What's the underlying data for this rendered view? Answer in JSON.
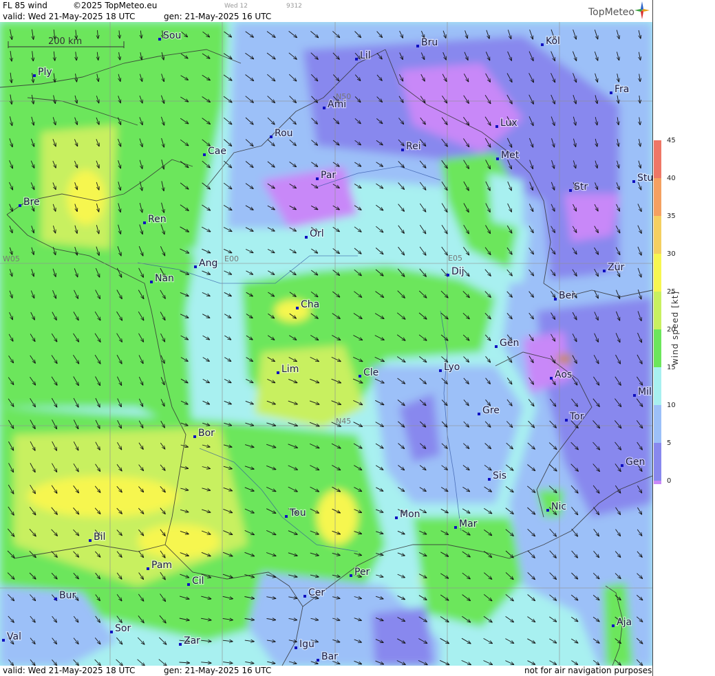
{
  "header": {
    "product": "FL 85 wind",
    "copyright": "©2025 TopMeteo.eu",
    "run_tag": "Wed 12",
    "code": "9312",
    "valid_line": "valid:  Wed  21-May-2025  18 UTC",
    "gen_line": "gen: 21-May-2025 16 UTC"
  },
  "logo": {
    "name": "TopMeteo"
  },
  "footer": {
    "valid_line": "valid:  Wed  21-May-2025  18 UTC",
    "gen_line": "gen: 21-May-2025 16 UTC",
    "disclaimer": "not for air navigation purposes"
  },
  "scale": {
    "label": "200 km"
  },
  "legend": {
    "title": "wind speed [kt]",
    "ticks": [
      "45",
      "40",
      "35",
      "30",
      "25",
      "20",
      "15",
      "10",
      "5",
      "0"
    ],
    "colors": [
      "#ee7766",
      "#f4a060",
      "#f4cf60",
      "#f6f650",
      "#c8f060",
      "#6ce65c",
      "#a8f0f0",
      "#9cc0f8",
      "#8888ee",
      "#c888f8"
    ]
  },
  "grid_labels": [
    "N50",
    "N45",
    "E00",
    "E05",
    "W05"
  ],
  "cities": [
    {
      "name": "Sou"
    },
    {
      "name": "Ply"
    },
    {
      "name": "Lil"
    },
    {
      "name": "Bru"
    },
    {
      "name": "Köl"
    },
    {
      "name": "Ami"
    },
    {
      "name": "Fra"
    },
    {
      "name": "Lux"
    },
    {
      "name": "Rou"
    },
    {
      "name": "Cae"
    },
    {
      "name": "Rei"
    },
    {
      "name": "Met"
    },
    {
      "name": "Par"
    },
    {
      "name": "Stu"
    },
    {
      "name": "Str"
    },
    {
      "name": "Bre"
    },
    {
      "name": "Ren"
    },
    {
      "name": "Orl"
    },
    {
      "name": "Ang"
    },
    {
      "name": "Dij"
    },
    {
      "name": "Zür"
    },
    {
      "name": "Nan"
    },
    {
      "name": "Ber"
    },
    {
      "name": "Cha"
    },
    {
      "name": "Gen"
    },
    {
      "name": "Lim"
    },
    {
      "name": "Cle"
    },
    {
      "name": "Lyo"
    },
    {
      "name": "Aos"
    },
    {
      "name": "Mil"
    },
    {
      "name": "Gre"
    },
    {
      "name": "Tor"
    },
    {
      "name": "Bor"
    },
    {
      "name": "Gen"
    },
    {
      "name": "Sis"
    },
    {
      "name": "Nic"
    },
    {
      "name": "Tou"
    },
    {
      "name": "Mon"
    },
    {
      "name": "Mar"
    },
    {
      "name": "Bil"
    },
    {
      "name": "Pam"
    },
    {
      "name": "Cil"
    },
    {
      "name": "Per"
    },
    {
      "name": "Cer"
    },
    {
      "name": "Bur"
    },
    {
      "name": "Sor"
    },
    {
      "name": "Aja"
    },
    {
      "name": "Val"
    },
    {
      "name": "Zar"
    },
    {
      "name": "Igu"
    },
    {
      "name": "Bar"
    }
  ]
}
